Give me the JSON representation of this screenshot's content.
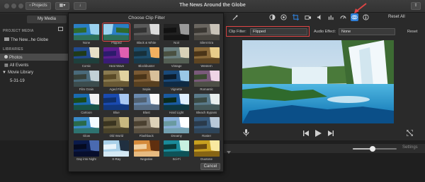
{
  "window": {
    "title": "The News Around the Globe",
    "projects_button": "Projects"
  },
  "sidebar": {
    "media_tab": "My Media",
    "project_media_header": "PROJECT MEDIA",
    "project_item": "The New...he Globe",
    "libraries_header": "LIBRARIES",
    "photos": "Photos",
    "all_events": "All Events",
    "movie_library": "Movie Library",
    "event_date": "5-31-19"
  },
  "dialog": {
    "title": "Choose Clip Filter",
    "cancel": "Cancel",
    "selected": "Flipped",
    "filters": [
      {
        "label": "None",
        "tint": "blue"
      },
      {
        "label": "Flipped",
        "tint": "blue"
      },
      {
        "label": "Black & White",
        "tint": "bw"
      },
      {
        "label": "Noir",
        "tint": "noir"
      },
      {
        "label": "Silent Era",
        "tint": "silent"
      },
      {
        "label": "Comic",
        "tint": "comic"
      },
      {
        "label": "Heat Wave",
        "tint": "heat"
      },
      {
        "label": "Blockbuster",
        "tint": "block"
      },
      {
        "label": "Vintage",
        "tint": "vintage"
      },
      {
        "label": "Western",
        "tint": "western"
      },
      {
        "label": "Film Grain",
        "tint": "grain"
      },
      {
        "label": "Aged Film",
        "tint": "aged"
      },
      {
        "label": "Sepia",
        "tint": "sepia"
      },
      {
        "label": "Vignette",
        "tint": "vignette"
      },
      {
        "label": "Romantic",
        "tint": "romantic"
      },
      {
        "label": "Cartoon",
        "tint": "cartoon"
      },
      {
        "label": "Blue",
        "tint": "bluef"
      },
      {
        "label": "Blast",
        "tint": "blast"
      },
      {
        "label": "Hard Light",
        "tint": "hard"
      },
      {
        "label": "Bleach Bypass",
        "tint": "bleach"
      },
      {
        "label": "Glow",
        "tint": "glow"
      },
      {
        "label": "Old World",
        "tint": "old"
      },
      {
        "label": "Flashback",
        "tint": "flash"
      },
      {
        "label": "Dreamy",
        "tint": "dreamy"
      },
      {
        "label": "Raster",
        "tint": "raster"
      },
      {
        "label": "Day into Night",
        "tint": "night"
      },
      {
        "label": "X-Ray",
        "tint": "xray"
      },
      {
        "label": "Negative",
        "tint": "negative"
      },
      {
        "label": "Sci-Fi",
        "tint": "scifi"
      },
      {
        "label": "Duotone",
        "tint": "duotone"
      }
    ]
  },
  "inspector": {
    "reset_all": "Reset All",
    "clip_filter_label": "Clip Filter:",
    "clip_filter_value": "Flipped",
    "audio_effect_label": "Audio Effect:",
    "audio_effect_value": "None",
    "reset": "Reset"
  },
  "timeline": {
    "settings": "Settings",
    "zoom_level": 0.45
  },
  "colors": {
    "highlight": "#e14545",
    "accent": "#2f7fd8"
  }
}
